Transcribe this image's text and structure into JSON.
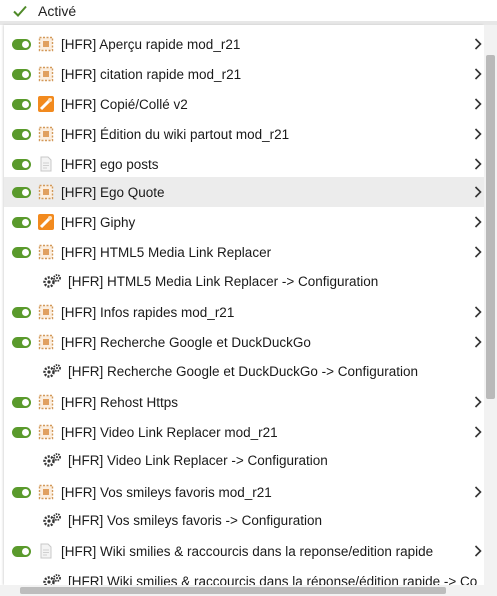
{
  "header": {
    "label": "Activé"
  },
  "menu": {
    "items": [
      {
        "label": "[HFR] Aperçu rapide mod_r21",
        "icon": "script-icon"
      },
      {
        "label": "[HFR] citation rapide mod_r21",
        "icon": "script-icon"
      },
      {
        "label": "[HFR] Copié/Collé v2",
        "icon": "orange-tool-icon"
      },
      {
        "label": "[HFR] Édition du wiki partout mod_r21",
        "icon": "script-icon"
      },
      {
        "label": "[HFR] ego posts",
        "icon": "document-icon"
      },
      {
        "label": "[HFR] Ego Quote",
        "icon": "script-icon"
      },
      {
        "label": "[HFR] Giphy",
        "icon": "orange-tool-icon"
      },
      {
        "label": "[HFR] HTML5 Media Link Replacer",
        "icon": "script-icon"
      },
      {
        "label": "[HFR] HTML5 Media Link Replacer -> Configuration",
        "icon": "gear-icon"
      },
      {
        "label": "[HFR] Infos rapides mod_r21",
        "icon": "script-icon"
      },
      {
        "label": "[HFR] Recherche Google et DuckDuckGo",
        "icon": "script-icon"
      },
      {
        "label": "[HFR] Recherche Google et DuckDuckGo -> Configuration",
        "icon": "gear-icon"
      },
      {
        "label": "[HFR] Rehost Https",
        "icon": "script-icon"
      },
      {
        "label": "[HFR] Video Link Replacer mod_r21",
        "icon": "script-icon"
      },
      {
        "label": "[HFR] Video Link Replacer -> Configuration",
        "icon": "gear-icon"
      },
      {
        "label": "[HFR] Vos smileys favoris mod_r21",
        "icon": "script-icon"
      },
      {
        "label": "[HFR] Vos smileys favoris -> Configuration",
        "icon": "gear-icon"
      },
      {
        "label": "[HFR] Wiki smilies & raccourcis dans la reponse/edition rapide",
        "icon": "document-icon"
      },
      {
        "label": "[HFR] Wiki smilies & raccourcis dans la réponse/édition rapide -> Co",
        "icon": "gear-icon"
      }
    ]
  },
  "colors": {
    "toggle_on": "#5a9a2c",
    "hover_row": "#ececec",
    "check": "#4f8a28"
  }
}
